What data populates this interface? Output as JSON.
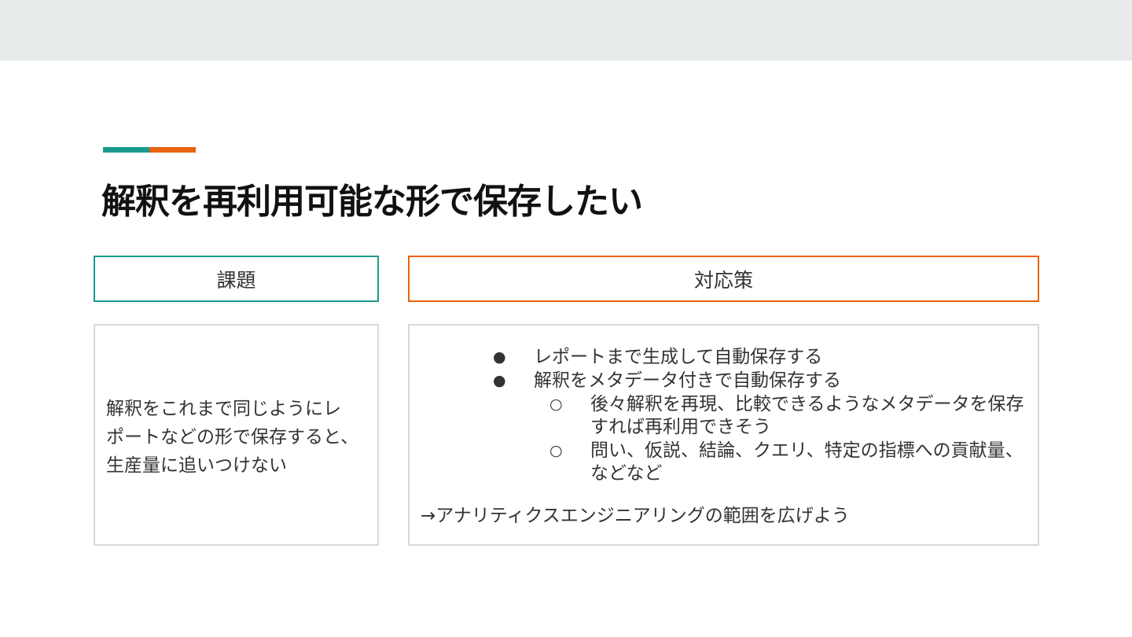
{
  "slide": {
    "title": "解釈を再利用可能な形で保存したい",
    "accent_colors": {
      "teal": "#1a9a8e",
      "orange": "#e8620f"
    }
  },
  "columns": {
    "issue": {
      "header": "課題",
      "body_lines": [
        "解釈をこれまで同じようにレ",
        "ポートなどの形で保存すると、",
        "生産量に追いつけない"
      ]
    },
    "solution": {
      "header": "対応策",
      "bullets": [
        {
          "marker": "●",
          "text": "レポートまで生成して自動保存する"
        },
        {
          "marker": "●",
          "text": "解釈をメタデータ付きで自動保存する"
        }
      ],
      "sub_bullets": [
        {
          "marker": "○",
          "lines": [
            "後々解釈を再現、比較できるようなメタデータを保存",
            "すれば再利用できそう"
          ]
        },
        {
          "marker": "○",
          "lines": [
            "問い、仮説、結論、クエリ、特定の指標への貢献量、",
            "などなど"
          ]
        }
      ],
      "conclusion": "→アナリティクスエンジニアリングの範囲を広げよう"
    }
  }
}
